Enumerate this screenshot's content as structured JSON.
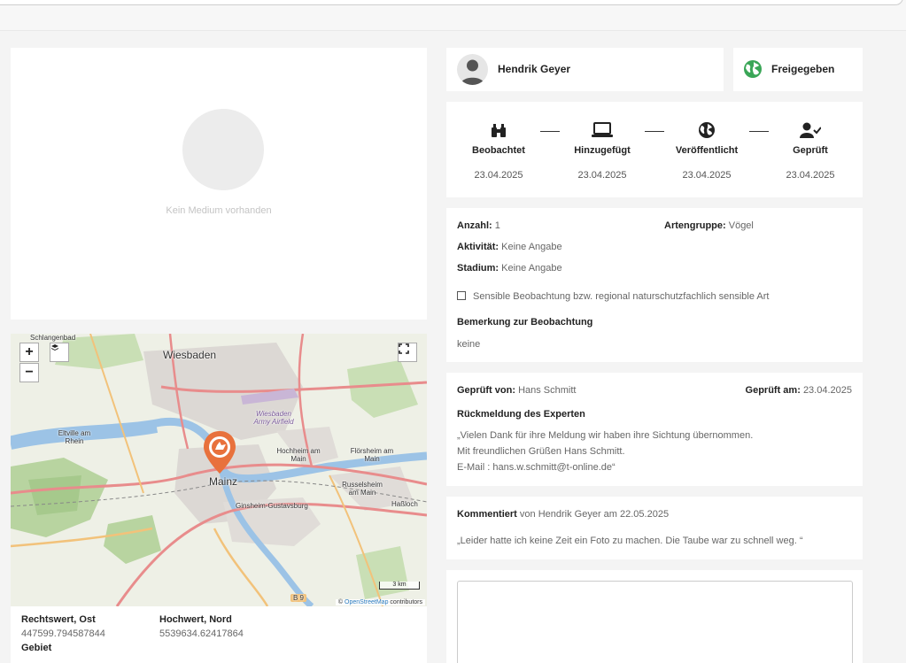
{
  "media": {
    "empty_text": "Kein Medium vorhanden"
  },
  "map": {
    "zoom_in": "+",
    "zoom_out": "−",
    "scale_label": "3 km",
    "attribution_prefix": "©",
    "attribution_link": "OpenStreetMap",
    "attribution_suffix": "contributors",
    "labels": {
      "wiesbaden": "Wiesbaden",
      "mainz": "Mainz",
      "schlangenbad": "Schlangenbad",
      "eltville": "Eltville am Rhein",
      "hochheim": "Hochheim am Main",
      "floersheim": "Flörsheim am Main",
      "ruesselsheim": "Russelsheim am Main",
      "ginsheim": "Ginsheim-Gustavsburg",
      "hassloch": "Haßloch",
      "airfield": "Wiesbaden Army Airfield",
      "b9": "B 9"
    }
  },
  "coords": {
    "rechtswert_label": "Rechtswert, Ost",
    "rechtswert_value": "447599.794587844",
    "hochwert_label": "Hochwert, Nord",
    "hochwert_value": "5539634.62417864",
    "gebiet_label": "Gebiet"
  },
  "user": {
    "name": "Hendrik Geyer"
  },
  "status": {
    "label": "Freigegeben",
    "color": "#3aa657"
  },
  "steps": [
    {
      "label": "Beobachtet",
      "date": "23.04.2025",
      "icon": "binoculars-icon"
    },
    {
      "label": "Hinzugefügt",
      "date": "23.04.2025",
      "icon": "laptop-icon"
    },
    {
      "label": "Veröffentlicht",
      "date": "23.04.2025",
      "icon": "globe-icon"
    },
    {
      "label": "Geprüft",
      "date": "23.04.2025",
      "icon": "user-check-icon"
    }
  ],
  "details": {
    "anzahl_label": "Anzahl:",
    "anzahl_value": "1",
    "artengruppe_label": "Artengruppe:",
    "artengruppe_value": "Vögel",
    "aktivitaet_label": "Aktivität:",
    "aktivitaet_value": "Keine Angabe",
    "stadium_label": "Stadium:",
    "stadium_value": "Keine Angabe",
    "sensible_label": "Sensible Beobachtung bzw. regional naturschutzfachlich sensible Art",
    "bemerkung_title": "Bemerkung zur Beobachtung",
    "bemerkung_value": "keine"
  },
  "review": {
    "geprueft_von_label": "Geprüft von:",
    "geprueft_von_value": "Hans Schmitt",
    "geprueft_am_label": "Geprüft am:",
    "geprueft_am_value": "23.04.2025",
    "rueckmeldung_title": "Rückmeldung des Experten",
    "line1": "„Vielen Dank für ihre Meldung wir haben ihre Sichtung übernommen.",
    "line2": "Mit freundlichen Grüßen Hans Schmitt.",
    "line3": "E-Mail : hans.w.schmitt@t-online.de“"
  },
  "comment": {
    "label": "Kommentiert",
    "meta": "von Hendrik Geyer am 22.05.2025",
    "text": "„Leider hatte ich keine Zeit ein Foto zu machen. Die Taube war zu schnell weg. “"
  }
}
